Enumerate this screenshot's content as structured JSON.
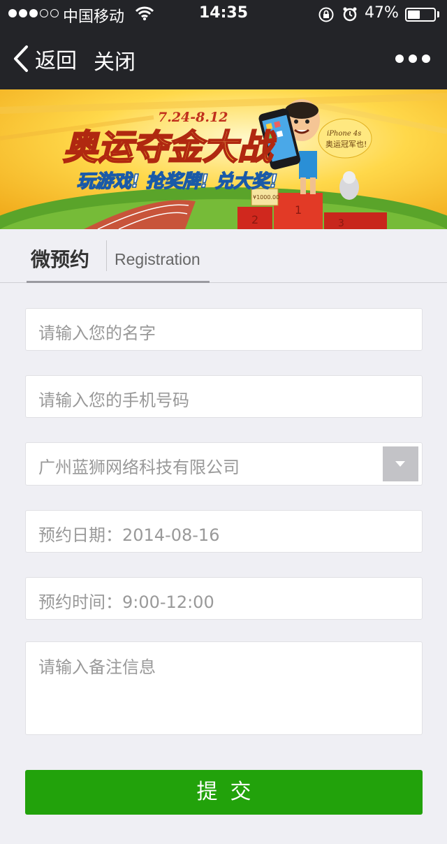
{
  "status_bar": {
    "carrier": "中国移动",
    "time": "14:35",
    "battery_percent": "47%",
    "battery_level": 0.47,
    "signal_bars_filled": 3,
    "signal_bars_total": 5
  },
  "nav": {
    "back_label": "返回",
    "close_label": "关闭",
    "more_icon": "more-dots-icon"
  },
  "banner": {
    "dates": "7.24-8.12",
    "title": "奥运夺金大战",
    "subtitle": "玩游戏! 抢奖牌! 兑大奖!",
    "bubble_line1": "iPhone 4s",
    "bubble_line2": "奥运冠军也!",
    "prize": "¥1000.00",
    "podium_numbers": [
      "2",
      "1",
      "3"
    ]
  },
  "tabs": {
    "active": "微预约",
    "secondary": "Registration"
  },
  "form": {
    "name_placeholder": "请输入您的名字",
    "phone_placeholder": "请输入您的手机号码",
    "company_selected": "广州蓝狮网络科技有限公司",
    "date_label": "预约日期：2014-08-16",
    "time_label": "预约时间：9:00-12:00",
    "note_placeholder": "请输入备注信息",
    "submit_label": "提交"
  },
  "colors": {
    "header_bg": "#232428",
    "page_bg": "#efeff4",
    "submit_bg": "#22a20b"
  }
}
